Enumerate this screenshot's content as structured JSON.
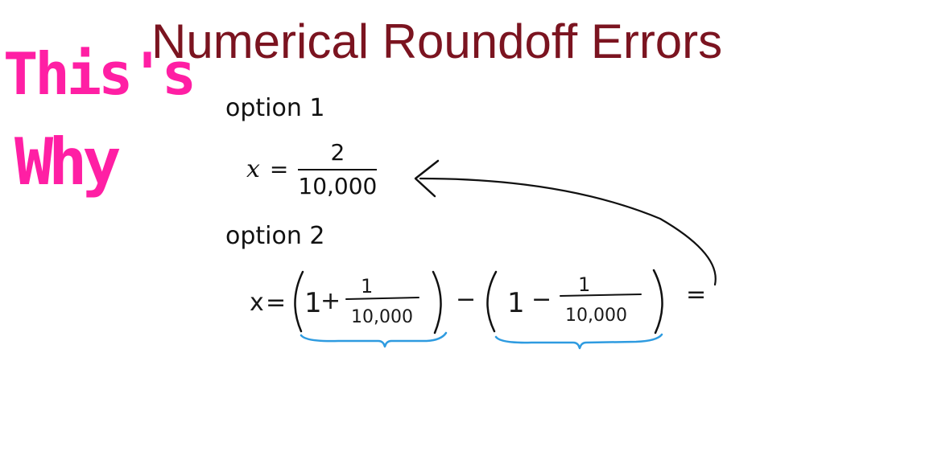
{
  "title": "Numerical Roundoff Errors",
  "option1": {
    "label": "option 1",
    "var": "x",
    "equals": "=",
    "numerator": "2",
    "denominator": "10,000"
  },
  "option2": {
    "label": "option 2",
    "var": "x",
    "equals": "=",
    "one_a": "1",
    "plus": "+",
    "num_a": "1",
    "den_a": "10,000",
    "minus_between": "−",
    "one_b": "1",
    "minus": "−",
    "num_b": "1",
    "den_b": "10,000",
    "trailing_equals": "="
  },
  "annotation": {
    "line1": "This's",
    "line2": "Why",
    "color": "#ff1fa4"
  },
  "colors": {
    "title": "#7b1420",
    "brace": "#2e9be0",
    "arrow": "#111111"
  }
}
